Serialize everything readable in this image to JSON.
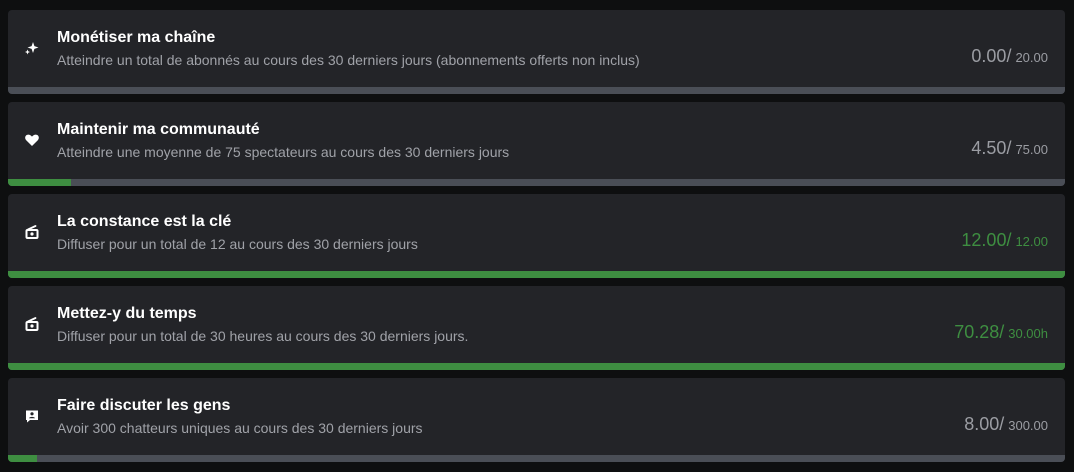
{
  "colors": {
    "background": "#0e0f10",
    "card": "#232428",
    "title": "#ffffff",
    "description": "#a0a2a8",
    "progress_text": "#9b9da3",
    "complete": "#3e8e41",
    "bar_track": "#4a4e56",
    "bar_fill": "#3e8e41"
  },
  "goals": [
    {
      "icon": "sparkle-icon",
      "title": "Monétiser ma chaîne",
      "description": "Atteindre un total de abonnés au cours des 30 derniers jours (abonnements offerts non inclus)",
      "current": "0.00/",
      "target": "20.00",
      "progress": 0.0,
      "complete": false
    },
    {
      "icon": "heart-icon",
      "title": "Maintenir ma communauté",
      "description": "Atteindre une moyenne de 75 spectateurs au cours des 30 derniers jours",
      "current": "4.50/",
      "target": "75.00",
      "progress": 0.06,
      "complete": false
    },
    {
      "icon": "broadcast-icon",
      "title": "La constance est la clé",
      "description": "Diffuser pour un total de 12 au cours des 30 derniers jours",
      "current": "12.00/",
      "target": "12.00",
      "progress": 1.0,
      "complete": true
    },
    {
      "icon": "broadcast-icon",
      "title": "Mettez-y du temps",
      "description": "Diffuser pour un total de 30 heures au cours des 30 derniers jours.",
      "current": "70.28/",
      "target": "30.00h",
      "progress": 1.0,
      "complete": true
    },
    {
      "icon": "chat-user-icon",
      "title": "Faire discuter les gens",
      "description": "Avoir 300 chatteurs uniques au cours des 30 derniers jours",
      "current": "8.00/",
      "target": "300.00",
      "progress": 0.027,
      "complete": false
    }
  ]
}
